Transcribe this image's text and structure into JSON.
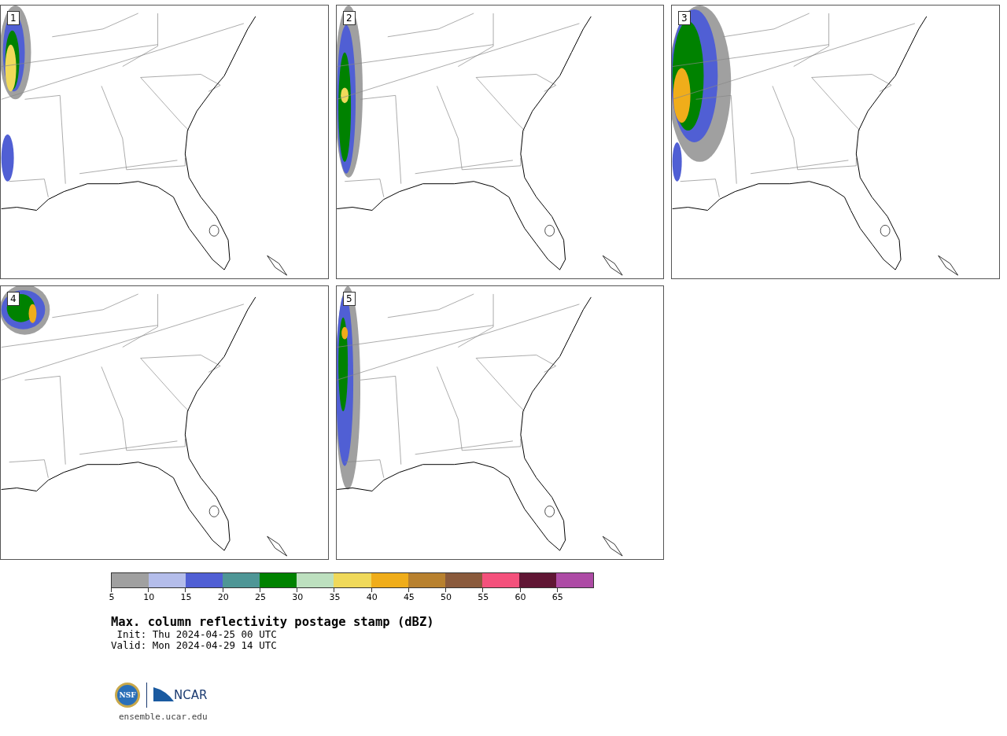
{
  "panels": [
    {
      "label": "1"
    },
    {
      "label": "2"
    },
    {
      "label": "3"
    },
    {
      "label": "4"
    },
    {
      "label": "5"
    }
  ],
  "colorbar": {
    "bins": [
      {
        "color": "#a0a0a0"
      },
      {
        "color": "#b4bdea"
      },
      {
        "color": "#505fd4"
      },
      {
        "color": "#4e9696"
      },
      {
        "color": "#008200"
      },
      {
        "color": "#bde0bf"
      },
      {
        "color": "#f0d95a"
      },
      {
        "color": "#f0ad1a"
      },
      {
        "color": "#b8812f"
      },
      {
        "color": "#8a5a3c"
      },
      {
        "color": "#f4517c"
      },
      {
        "color": "#601634"
      },
      {
        "color": "#ad4ba5"
      }
    ],
    "ticks": [
      "5",
      "10",
      "15",
      "20",
      "25",
      "30",
      "35",
      "40",
      "45",
      "50",
      "55",
      "60",
      "65"
    ]
  },
  "title": "Max. column reflectivity postage stamp (dBZ)",
  "init": " Init: Thu 2024-04-25 00 UTC",
  "valid": "Valid: Mon 2024-04-29 14 UTC",
  "logos": {
    "nsf": "NSF",
    "ncar": "NCAR"
  },
  "website": "ensemble.ucar.edu"
}
